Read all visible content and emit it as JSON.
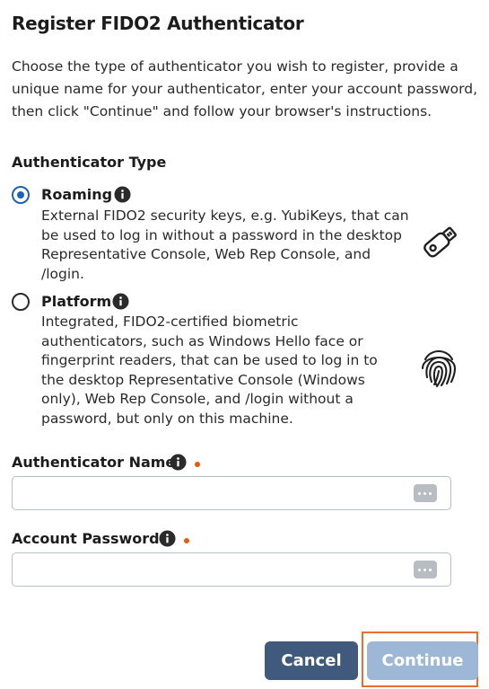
{
  "dialog": {
    "title": "Register FIDO2 Authenticator",
    "intro": "Choose the type of authenticator you wish to register, provide a unique name for your authenticator, enter your account password, then click \"Continue\" and follow your browser's instructions."
  },
  "authenticator_type": {
    "label": "Authenticator Type",
    "options": [
      {
        "label": "Roaming",
        "selected": true,
        "description": "External FIDO2 security keys, e.g. YubiKeys, that can be used to log in without a password in the desktop Representative Console, Web Rep Console, and /login.",
        "icon": "usb-key-icon"
      },
      {
        "label": "Platform",
        "selected": false,
        "description": "Integrated, FIDO2-certified biometric authenticators, such as Windows Hello face or fingerprint readers, that can be used to log in to the desktop Representative Console (Windows only), Web Rep Console, and /login without a password, but only on this machine.",
        "icon": "fingerprint-icon"
      }
    ]
  },
  "fields": {
    "name_label": "Authenticator Name",
    "name_value": "",
    "password_label": "Account Password",
    "password_value": ""
  },
  "buttons": {
    "cancel": "Cancel",
    "continue": "Continue"
  },
  "colors": {
    "accent": "#1b63b5",
    "required": "#e8590c",
    "cancel_bg": "#3f5a7c",
    "continue_bg_disabled": "#9db7d6",
    "highlight": "#ef6a2f"
  }
}
